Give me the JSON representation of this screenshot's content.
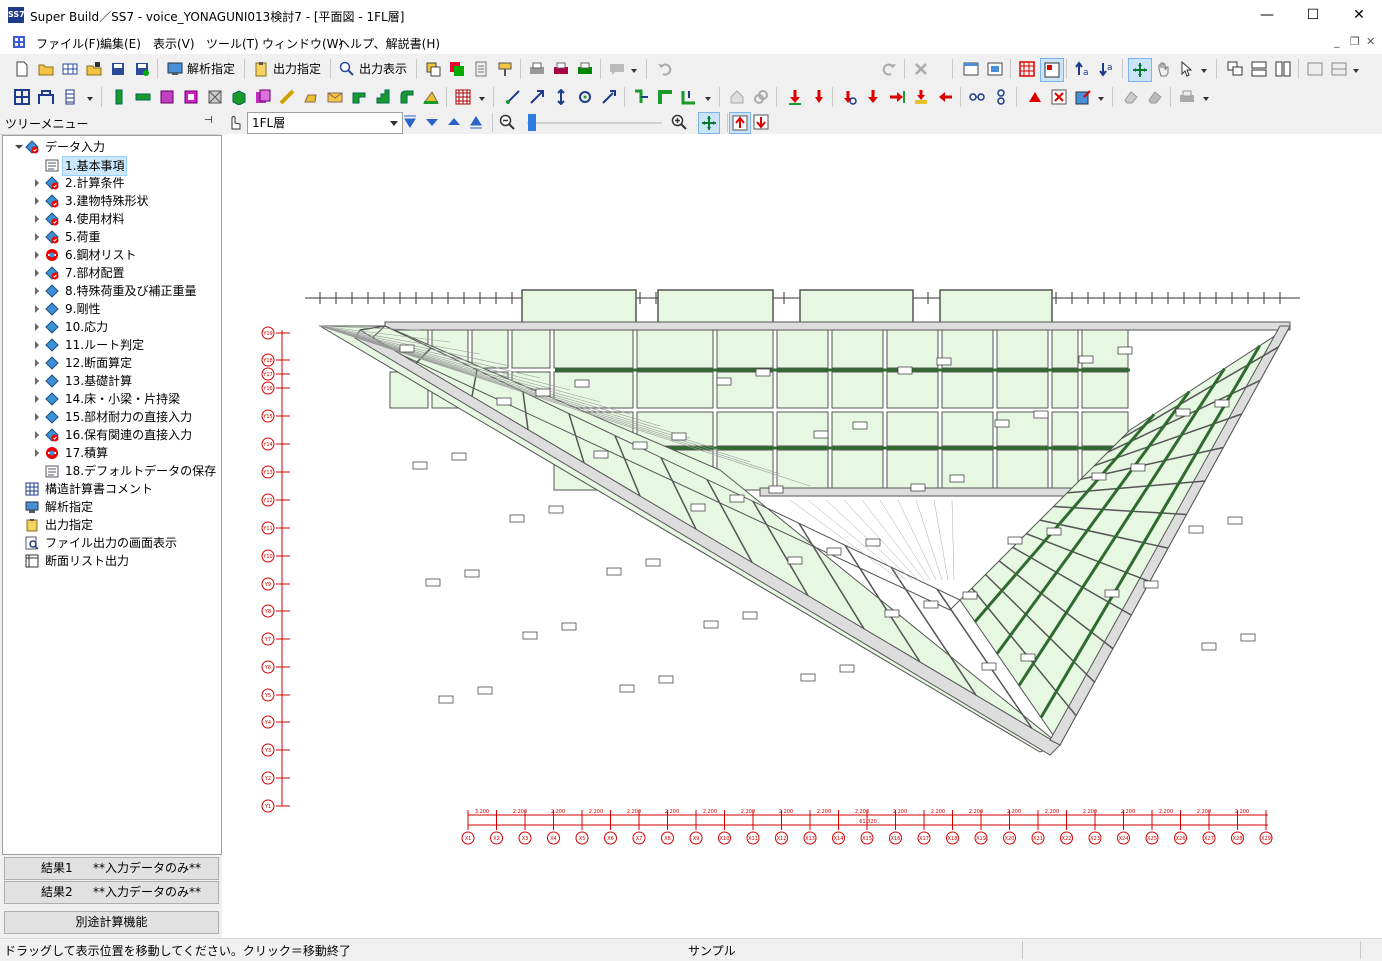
{
  "window": {
    "title": "Super Build／SS7 - voice_YONAGUNI013検討7 - [平面図 - 1FL層]",
    "app_icon_text": "SS7",
    "minimize": "—",
    "maximize": "☐",
    "close": "✕"
  },
  "menu": {
    "items": [
      "ファイル(F)",
      "編集(E)",
      "表示(V)",
      "ツール(T)",
      "ウィンドウ(W)",
      "ヘルプ、解説書(H)"
    ],
    "mdi_controls": [
      "_",
      "❐",
      "✕"
    ]
  },
  "toolbar1": {
    "analysis_label": "解析指定",
    "output_label": "出力指定",
    "output_view_label": "出力表示"
  },
  "layer_bar": {
    "selected_layer": "1FL層"
  },
  "tree": {
    "header": "ツリーメニュー",
    "pin_icon": "pin-icon",
    "root": "データ入力",
    "items": [
      {
        "label": "1.基本事項",
        "icon": "document-icon",
        "selected": true
      },
      {
        "label": "2.計算条件",
        "icon": "blue-check-icon"
      },
      {
        "label": "3.建物特殊形状",
        "icon": "blue-check-icon"
      },
      {
        "label": "4.使用材料",
        "icon": "blue-check-icon"
      },
      {
        "label": "5.荷重",
        "icon": "blue-check-icon"
      },
      {
        "label": "6.鋼材リスト",
        "icon": "no-entry-icon"
      },
      {
        "label": "7.部材配置",
        "icon": "blue-check-icon"
      },
      {
        "label": "8.特殊荷重及び補正重量",
        "icon": "blue-diamond-icon"
      },
      {
        "label": "9.剛性",
        "icon": "blue-diamond-icon"
      },
      {
        "label": "10.応力",
        "icon": "blue-diamond-icon"
      },
      {
        "label": "11.ルート判定",
        "icon": "blue-diamond-icon"
      },
      {
        "label": "12.断面算定",
        "icon": "blue-diamond-icon"
      },
      {
        "label": "13.基礎計算",
        "icon": "blue-diamond-icon"
      },
      {
        "label": "14.床・小梁・片持梁",
        "icon": "blue-diamond-icon"
      },
      {
        "label": "15.部材耐力の直接入力",
        "icon": "blue-diamond-icon"
      },
      {
        "label": "16.保有関連の直接入力",
        "icon": "blue-check-icon"
      },
      {
        "label": "17.積算",
        "icon": "no-entry-icon"
      },
      {
        "label": "18.デフォルトデータの保存",
        "icon": "document-icon"
      }
    ],
    "top_items": [
      {
        "label": "構造計算書コメント",
        "icon": "grid-doc-icon"
      },
      {
        "label": "解析指定",
        "icon": "monitor-icon"
      },
      {
        "label": "出力指定",
        "icon": "clipboard-icon"
      },
      {
        "label": "ファイル出力の画面表示",
        "icon": "search-doc-icon"
      },
      {
        "label": "断面リスト出力",
        "icon": "table-icon"
      }
    ]
  },
  "result_buttons": [
    {
      "label": "結果1",
      "value": "**入力データのみ**"
    },
    {
      "label": "結果2",
      "value": "**入力データのみ**"
    }
  ],
  "separate_calc_button": "別途計算機能",
  "status": {
    "message": "ドラッグして表示位置を移動してください。クリック＝移動終了",
    "mode": "サンプル"
  },
  "plan": {
    "y_axis_labels": [
      "Y19",
      "Y18",
      "Y17",
      "Y16",
      "Y15",
      "Y14",
      "Y13",
      "Y12",
      "Y11",
      "Y10",
      "Y9",
      "Y8",
      "Y7",
      "Y6",
      "Y5",
      "Y4",
      "Y3",
      "Y2",
      "Y1"
    ],
    "x_axis_labels": [
      "X1",
      "X2",
      "X3",
      "X4",
      "X5",
      "X6",
      "X7",
      "X8",
      "X9",
      "X10",
      "X11",
      "X12",
      "X13",
      "X14",
      "X15",
      "X16",
      "X17",
      "X18",
      "X19",
      "X20",
      "X21",
      "X22",
      "X23",
      "X24",
      "X25",
      "X26",
      "X27",
      "X28",
      "X29"
    ],
    "span_labels": [
      "3.200",
      "2.200",
      "2.200",
      "2.200",
      "2.200",
      "2.200",
      "2.200",
      "2.200",
      "2.200",
      "2.200",
      "2.200",
      "2.200",
      "2.200",
      "2.200",
      "2.200",
      "2.200",
      "2.200",
      "2.200",
      "2.200",
      "2.200",
      "2.200"
    ],
    "total_span": "61.320",
    "colors": {
      "slab": "#e6f7e2",
      "beam": "#555555",
      "wall": "#2f6b2f",
      "axis": "#d40000"
    }
  }
}
